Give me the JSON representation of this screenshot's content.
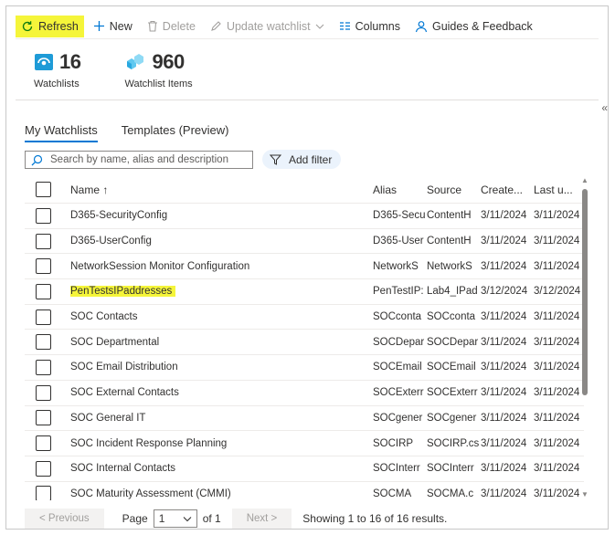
{
  "toolbar": {
    "refresh": "Refresh",
    "new": "New",
    "delete": "Delete",
    "update_watchlist": "Update watchlist",
    "columns": "Columns",
    "guides": "Guides & Feedback"
  },
  "stats": {
    "watchlists_value": "16",
    "watchlists_label": "Watchlists",
    "items_value": "960",
    "items_label": "Watchlist Items"
  },
  "tabs": [
    "My Watchlists",
    "Templates (Preview)"
  ],
  "search": {
    "placeholder": "Search by name, alias and description"
  },
  "filter": {
    "label": "Add filter"
  },
  "table": {
    "columns": [
      "Name ↑",
      "Alias",
      "Source",
      "Create...",
      "Last u..."
    ],
    "rows": [
      {
        "name": "D365-SecurityConfig",
        "alias": "D365-Secu",
        "source": "ContentH",
        "created": "3/11/2024",
        "last": "3/11/2024"
      },
      {
        "name": "D365-UserConfig",
        "alias": "D365-User",
        "source": "ContentH",
        "created": "3/11/2024",
        "last": "3/11/2024"
      },
      {
        "name": "NetworkSession Monitor Configuration",
        "alias": "NetworkS",
        "source": "NetworkS",
        "created": "3/11/2024",
        "last": "3/11/2024"
      },
      {
        "name": "PenTestsIPaddresses",
        "alias": "PenTestIP:",
        "source": "Lab4_IPad",
        "created": "3/12/2024",
        "last": "3/12/2024",
        "highlight": true
      },
      {
        "name": "SOC Contacts",
        "alias": "SOCconta",
        "source": "SOCconta",
        "created": "3/11/2024",
        "last": "3/11/2024"
      },
      {
        "name": "SOC Departmental",
        "alias": "SOCDepar",
        "source": "SOCDepar",
        "created": "3/11/2024",
        "last": "3/11/2024"
      },
      {
        "name": "SOC Email Distribution",
        "alias": "SOCEmail",
        "source": "SOCEmail",
        "created": "3/11/2024",
        "last": "3/11/2024"
      },
      {
        "name": "SOC External Contacts",
        "alias": "SOCExterr",
        "source": "SOCExterr",
        "created": "3/11/2024",
        "last": "3/11/2024"
      },
      {
        "name": "SOC General IT",
        "alias": "SOCgener",
        "source": "SOCgener",
        "created": "3/11/2024",
        "last": "3/11/2024"
      },
      {
        "name": "SOC Incident Response Planning",
        "alias": "SOCIRP",
        "source": "SOCIRP.cs",
        "created": "3/11/2024",
        "last": "3/11/2024"
      },
      {
        "name": "SOC Internal Contacts",
        "alias": "SOCInterr",
        "source": "SOCInterr",
        "created": "3/11/2024",
        "last": "3/11/2024"
      },
      {
        "name": "SOC Maturity Assessment (CMMI)",
        "alias": "SOCMA",
        "source": "SOCMA.c",
        "created": "3/11/2024",
        "last": "3/11/2024"
      }
    ]
  },
  "pager": {
    "previous": "< Previous",
    "page_label": "Page",
    "page_value": "1",
    "of": "of 1",
    "next": "Next >",
    "summary": "Showing 1 to 16 of 16 results."
  },
  "colors": {
    "highlight": "#f5f53a",
    "accent": "#0078d4"
  }
}
